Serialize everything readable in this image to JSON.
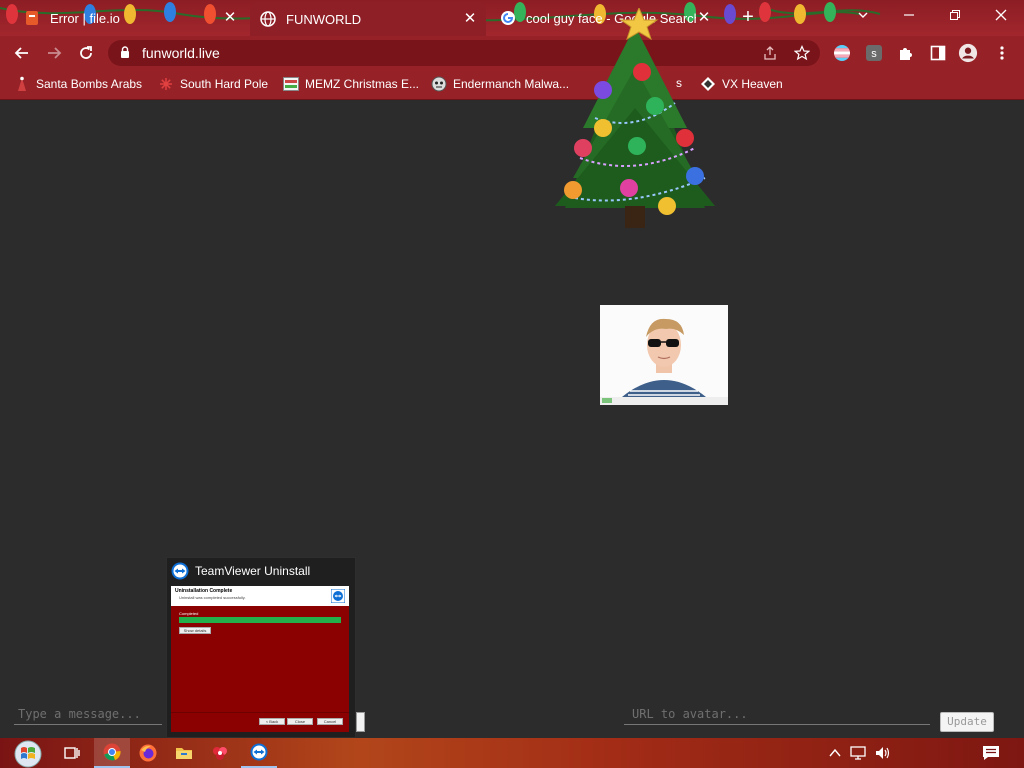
{
  "browser": {
    "tabs": [
      {
        "title": "Error | file.io",
        "favicon": "file-io-icon",
        "active": false
      },
      {
        "title": "FUNWORLD",
        "favicon": "globe-icon",
        "active": true
      },
      {
        "title": "cool guy face - Google Search",
        "favicon": "google-icon",
        "active": false
      }
    ],
    "new_tab_glyph": "+",
    "address": {
      "url": "funworld.live"
    },
    "bookmarks": [
      {
        "label": "Santa Bombs Arabs",
        "icon": "santa-icon"
      },
      {
        "label": "South Hard Pole",
        "icon": "snowflake-icon"
      },
      {
        "label": "MEMZ Christmas E...",
        "icon": "memz-icon"
      },
      {
        "label": "Endermanch Malwa...",
        "icon": "endermanch-icon"
      },
      {
        "label": "s",
        "icon": "folder-icon"
      },
      {
        "label": "VX Heaven",
        "icon": "vx-heaven-icon"
      }
    ]
  },
  "page": {
    "message_placeholder": "Type a message...",
    "avatar_url_placeholder": "URL to avatar...",
    "update_button": "Update",
    "avatar_alt": "cool guy face"
  },
  "taskbar_preview": {
    "title": "TeamViewer Uninstall",
    "header_title": "Uninstallation Complete",
    "header_subtitle": "Uninstall was completed successfully.",
    "status_label": "Completed",
    "progress": 1.0,
    "details_button": "Show details",
    "footer_buttons": [
      "< Back",
      "Close",
      "Cancel"
    ]
  },
  "taskbar": {
    "apps": [
      "start-orb",
      "task-view",
      "chrome",
      "firefox",
      "file-explorer",
      "app-red",
      "teamviewer"
    ]
  },
  "colors": {
    "chrome_frame": "#962228",
    "page_bg": "#2c2c2c",
    "progress_green": "#22b04a"
  }
}
